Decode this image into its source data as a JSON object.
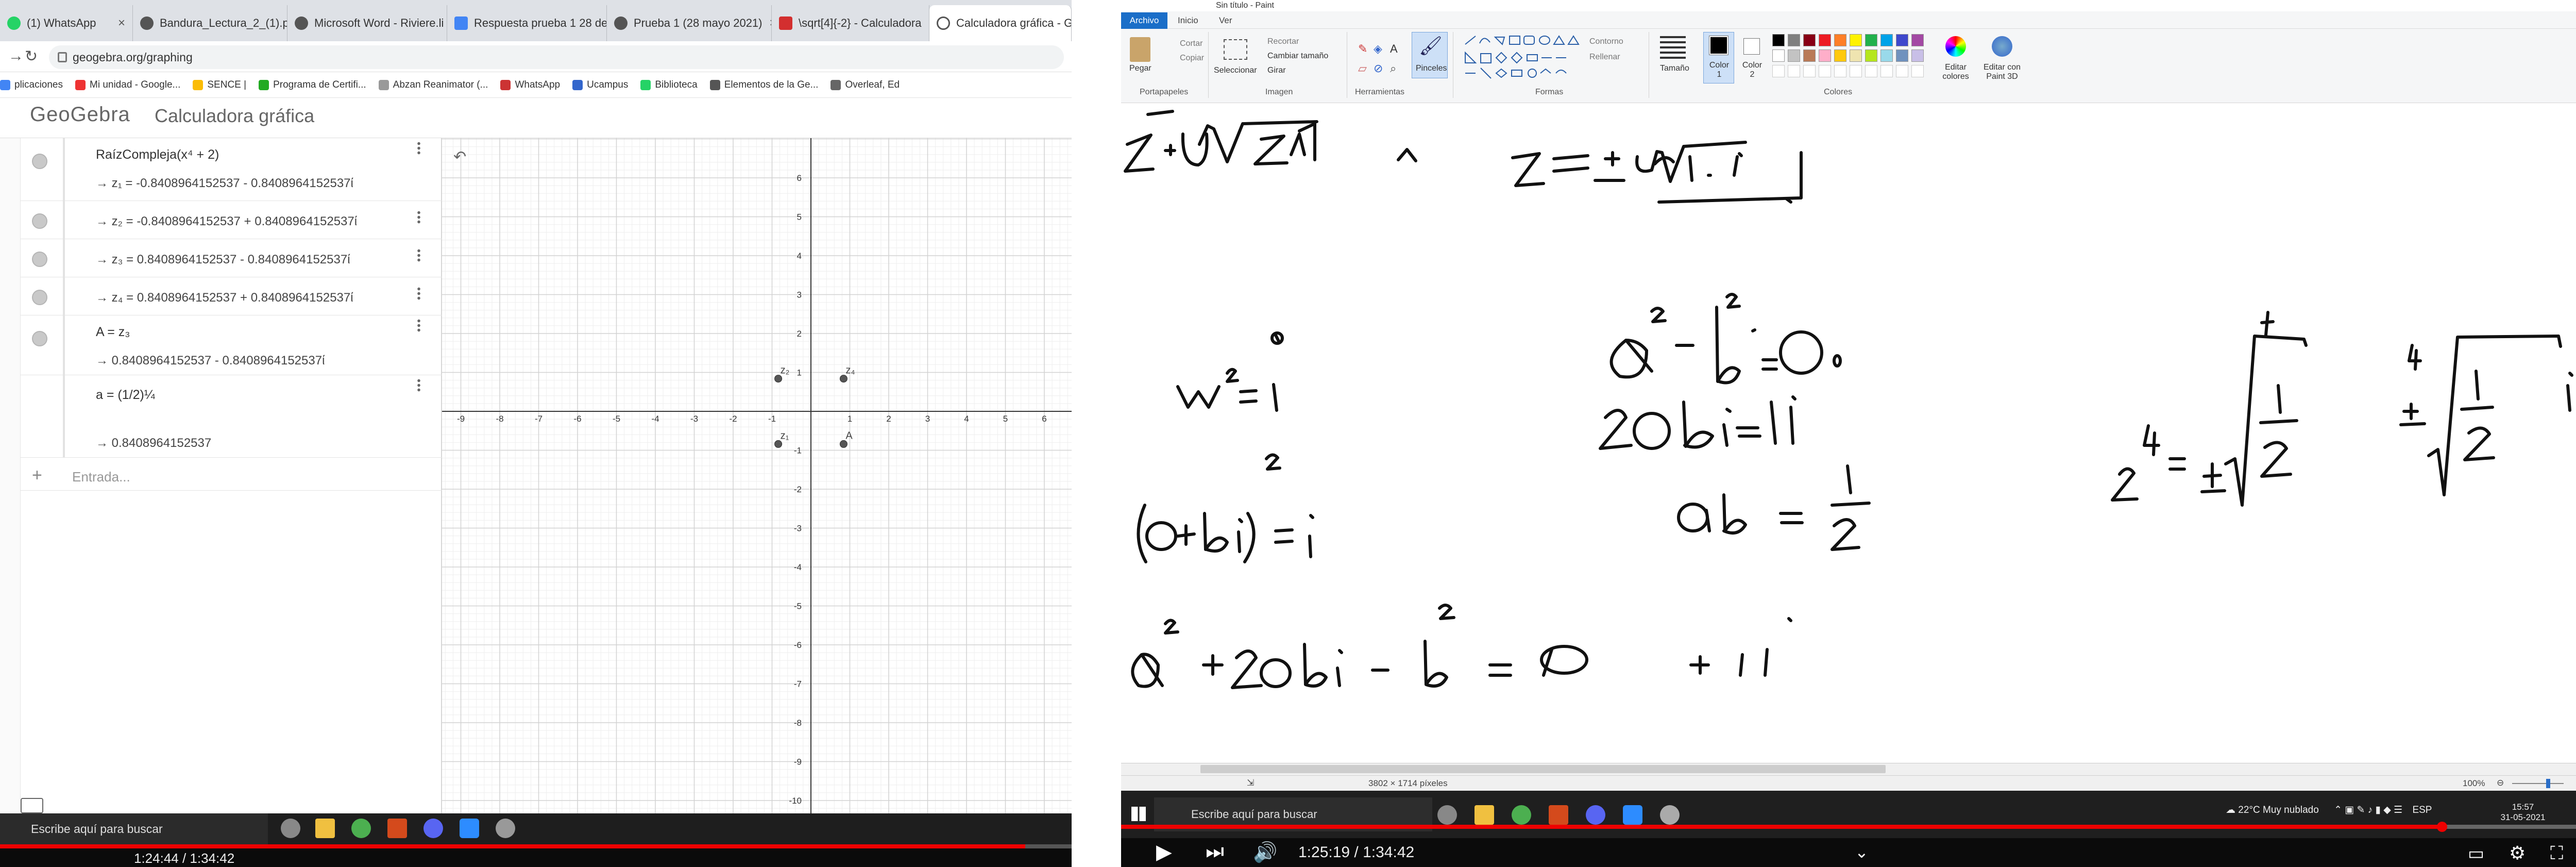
{
  "left_video": {
    "browser": {
      "tabs": [
        {
          "label": "(1) WhatsApp",
          "active": false
        },
        {
          "label": "Bandura_Lectura_2_(1).pdf",
          "active": false
        },
        {
          "label": "Microsoft Word - Riviere.li",
          "active": false
        },
        {
          "label": "Respuesta prueba 1 28 de",
          "active": false
        },
        {
          "label": "Prueba 1 (28 mayo 2021)",
          "active": false
        },
        {
          "label": "\\sqrt[4]{-2} - Calculadora",
          "active": false
        },
        {
          "label": "Calculadora gráfica - Geo",
          "active": true
        }
      ],
      "url": "geogebra.org/graphing",
      "bookmarks": [
        "plicaciones",
        "Mi unidad - Google...",
        "SENCE |",
        "Programa de Certifi...",
        "Abzan Reanimator (...",
        "WhatsApp",
        "Ucampus",
        "Biblioteca",
        "Elementos de la Ge...",
        "Overleaf, Ed"
      ]
    },
    "geogebra": {
      "logo": "GeoGebra",
      "subtitle": "Calculadora gráfica",
      "algebra": [
        {
          "def": "RaízCompleja(x⁴ + 2)",
          "out": "→  z₁ = -0.8408964152537 - 0.8408964152537ί"
        },
        {
          "def": "",
          "out": "→  z₂ = -0.8408964152537 + 0.8408964152537ί"
        },
        {
          "def": "",
          "out": "→  z₃ = 0.8408964152537 - 0.8408964152537ί"
        },
        {
          "def": "",
          "out": "→  z₄ = 0.8408964152537 + 0.8408964152537ί"
        },
        {
          "def": "A = z₃",
          "out": "→  0.8408964152537 - 0.8408964152537ί"
        },
        {
          "def": "a = (1/2)¼",
          "out": "→  0.8408964152537"
        }
      ],
      "input_placeholder": "Entrada...",
      "x_ticks": [
        "-9",
        "-8",
        "-7",
        "-6",
        "-5",
        "-4",
        "-3",
        "-2",
        "-1",
        "1",
        "2",
        "3",
        "4",
        "5",
        "6"
      ],
      "y_ticks": [
        "6",
        "5",
        "4",
        "3",
        "2",
        "1",
        "-1",
        "-2",
        "-3",
        "-4",
        "-5",
        "-6",
        "-7",
        "-8",
        "-9",
        "-10"
      ],
      "points": [
        {
          "label": "z₂",
          "x": -0.84,
          "y": 0.84
        },
        {
          "label": "z₄",
          "x": 0.84,
          "y": 0.84
        },
        {
          "label": "z₁",
          "x": -0.84,
          "y": -0.84
        },
        {
          "label": "A",
          "x": 0.84,
          "y": -0.84
        }
      ]
    },
    "taskbar_search": "Escribe aquí para buscar",
    "player_time": "1:24:44 / 1:34:42"
  },
  "right_video": {
    "paint": {
      "window_title": "Sin título - Paint",
      "tabs": [
        "Archivo",
        "Inicio",
        "Ver"
      ],
      "groups": {
        "clipboard": {
          "label": "Portapapeles",
          "paste": "Pegar",
          "cut": "Cortar",
          "copy": "Copiar"
        },
        "image": {
          "label": "Imagen",
          "select": "Seleccionar",
          "crop": "Recortar",
          "resize": "Cambiar tamaño",
          "rotate": "Girar"
        },
        "tools": {
          "label": "Herramientas"
        },
        "brushes": "Pinceles",
        "shapes": {
          "label": "Formas",
          "outline": "Contorno",
          "fill": "Rellenar"
        },
        "size": "Tamaño",
        "color1": "Color 1",
        "color2": "Color 2",
        "colors_label": "Colores",
        "edit_colors": "Editar colores",
        "paint3d": "Editar con Paint 3D"
      },
      "palette": [
        "#000000",
        "#7f7f7f",
        "#880015",
        "#ed1c24",
        "#ff7f27",
        "#fff200",
        "#22b14c",
        "#00a2e8",
        "#3f48cc",
        "#a349a4",
        "#ffffff",
        "#c3c3c3",
        "#b97a57",
        "#ffaec9",
        "#ffc90e",
        "#efe4b0",
        "#b5e61d",
        "#99d9ea",
        "#7092be",
        "#c8bfe7"
      ],
      "canvas_size": "3802 × 1714 píxeles",
      "zoom": "100%"
    },
    "taskbar_search": "Escribe aquí para buscar",
    "weather": "22°C  Muy nublado",
    "lang": "ESP",
    "clock_time": "15:57",
    "clock_date": "31-05-2021",
    "player_time": "1:25:19 / 1:34:42"
  }
}
